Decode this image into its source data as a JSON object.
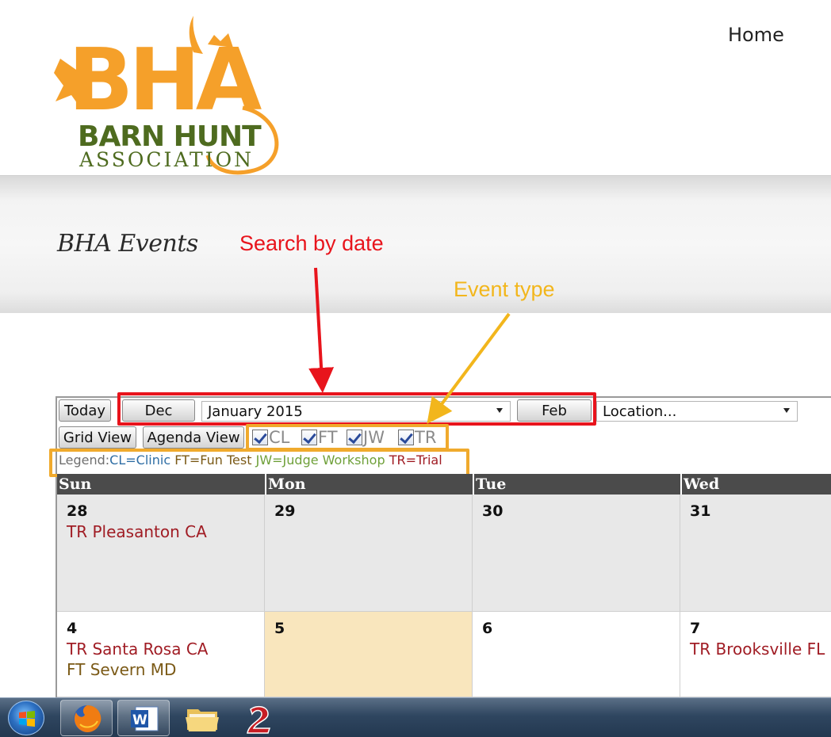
{
  "brand": {
    "logo_main": "BHA",
    "logo_line1": "BARN HUNT",
    "logo_line2": "ASSOCIATION"
  },
  "nav": {
    "home": "Home"
  },
  "page": {
    "title": "BHA Events"
  },
  "annotations": {
    "search_by_date": "Search by date",
    "event_type": "Event type"
  },
  "toolbar": {
    "today": "Today",
    "prev_month": "Dec",
    "month_select": "January 2015",
    "next_month": "Feb",
    "location_select": "Location...",
    "grid_view": "Grid View",
    "agenda_view": "Agenda View"
  },
  "filters": [
    {
      "code": "CL",
      "checked": true
    },
    {
      "code": "FT",
      "checked": true
    },
    {
      "code": "JW",
      "checked": true
    },
    {
      "code": "TR",
      "checked": true
    }
  ],
  "legend": {
    "title": "Legend:",
    "cl": "CL=Clinic",
    "ft": "FT=Fun Test",
    "jw": "JW=Judge Workshop",
    "tr": "TR=Trial"
  },
  "calendar": {
    "days": [
      "Sun",
      "Mon",
      "Tue",
      "Wed"
    ],
    "week1": [
      {
        "day": "28",
        "events": [
          "TR Pleasanton CA"
        ]
      },
      {
        "day": "29",
        "events": []
      },
      {
        "day": "30",
        "events": []
      },
      {
        "day": "31",
        "events": []
      }
    ],
    "week2": [
      {
        "day": "4",
        "events": [
          "TR Santa Rosa CA",
          "FT Severn MD"
        ]
      },
      {
        "day": "5",
        "events": []
      },
      {
        "day": "6",
        "events": []
      },
      {
        "day": "7",
        "events": [
          "TR Brooksville FL"
        ]
      }
    ]
  },
  "colors": {
    "logo_orange": "#f5a02a",
    "logo_green": "#4e6b1f",
    "trial": "#a01c24",
    "fun_test": "#7b5a17",
    "annotation_red": "#e8141c",
    "annotation_orange": "#f0aa2d",
    "other_month_bg": "#e8e8e8",
    "today_bg": "#f9e6bd"
  },
  "taskbar": {
    "apps": [
      "start-icon",
      "firefox-icon",
      "word-icon",
      "file-explorer-icon",
      "game-icon"
    ]
  }
}
